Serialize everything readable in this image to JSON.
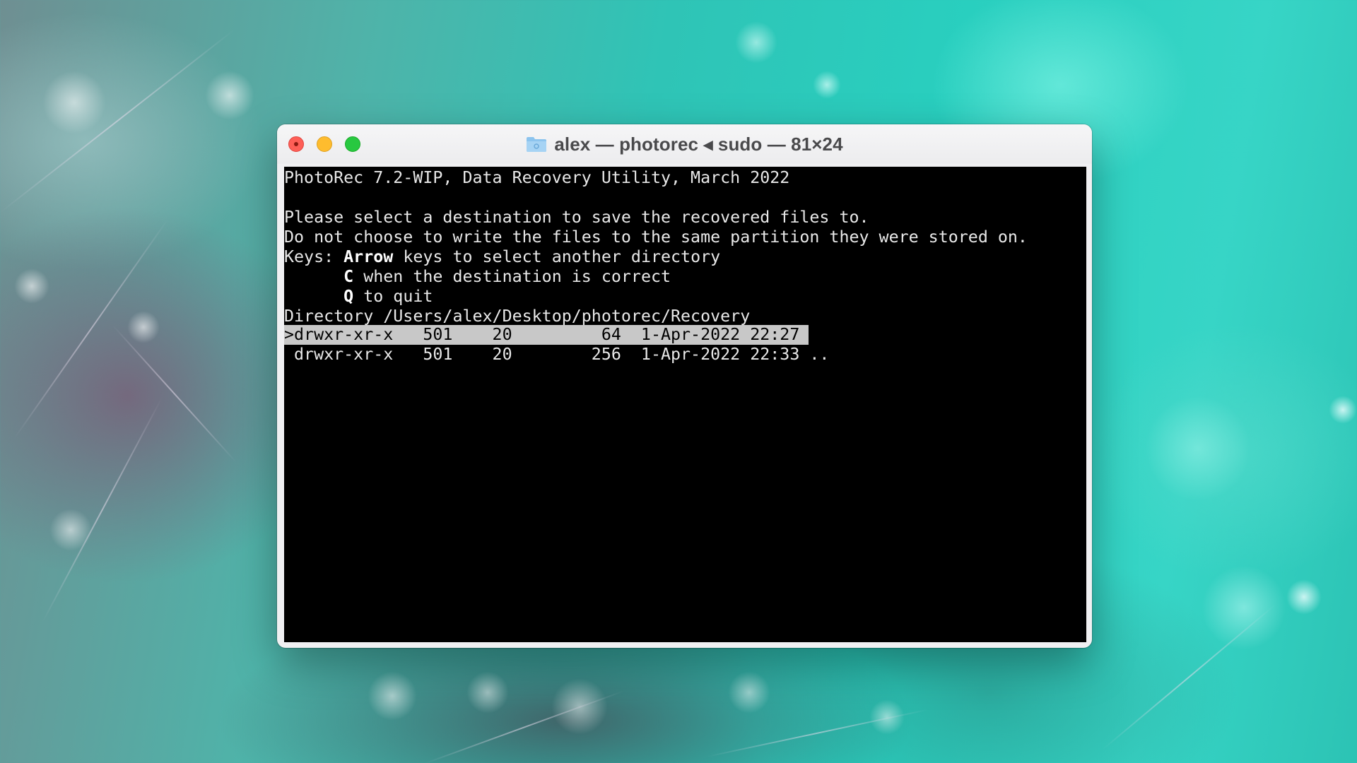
{
  "window": {
    "title": "alex — photorec ◂ sudo — 81×24"
  },
  "terminal": {
    "header": "PhotoRec 7.2-WIP, Data Recovery Utility, March 2022",
    "instruction_1": "Please select a destination to save the recovered files to.",
    "instruction_2": "Do not choose to write the files to the same partition they were stored on.",
    "keys_label": "Keys: ",
    "key_arrow": "Arrow",
    "key_arrow_desc": " keys to select another directory",
    "key_c": "C",
    "key_c_desc": " when the destination is correct",
    "key_q": "Q",
    "key_q_desc": " to quit",
    "directory_line": "Directory /Users/alex/Desktop/photorec/Recovery",
    "rows": [
      {
        "text": ">drwxr-xr-x   501    20         64  1-Apr-2022 22:27 ."
      },
      {
        "text": " drwxr-xr-x   501    20        256  1-Apr-2022 22:33 .."
      }
    ]
  },
  "colors": {
    "terminal_bg": "#000000",
    "terminal_fg": "#e8e8e8",
    "selection_bg": "#c8c8c8",
    "close": "#fe5f57",
    "minimize": "#febc2e",
    "maximize": "#28c840"
  },
  "icons": {
    "title_icon": "folder-icon"
  }
}
